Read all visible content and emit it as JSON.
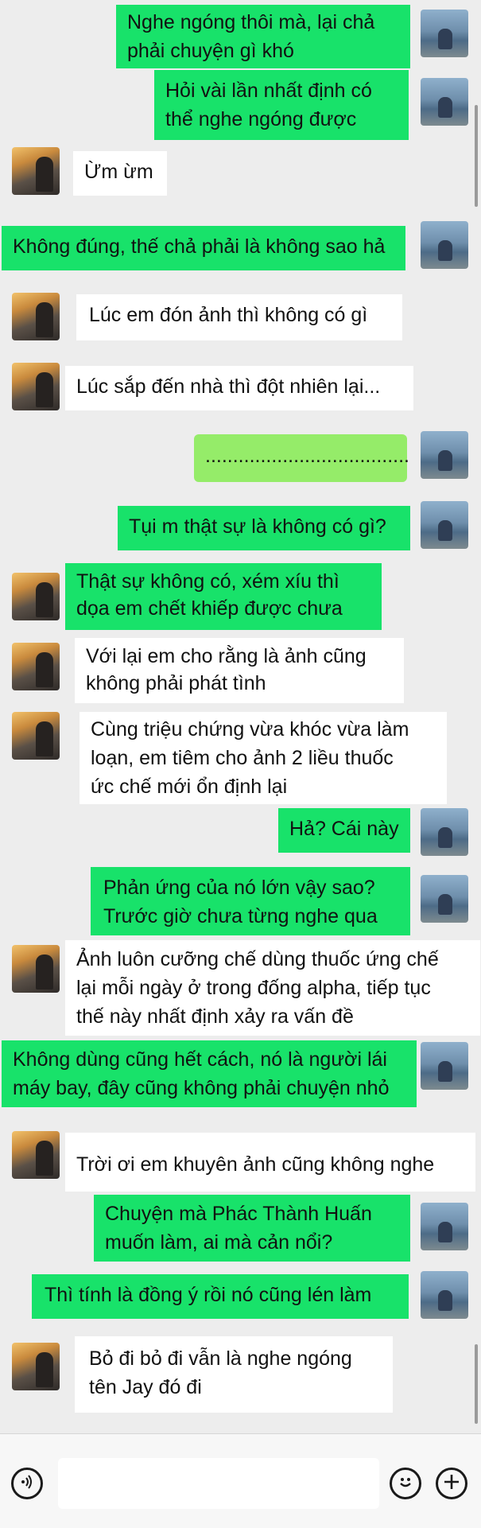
{
  "messages": [
    {
      "text": "Nghe ngóng thôi mà, lại chả\nphải chuyện gì khó"
    },
    {
      "text": "Hỏi vài lần nhất định có\nthể nghe ngóng được"
    },
    {
      "text": "Ừm ừm"
    },
    {
      "text": "Không đúng, thế chả phải là không sao hả"
    },
    {
      "text": "Lúc em đón ảnh thì không có gì"
    },
    {
      "text": "Lúc sắp đến nhà thì đột nhiên lại..."
    },
    {
      "text": "....................................."
    },
    {
      "text": "Tụi m thật sự là không có gì?"
    },
    {
      "text": "Thật sự không có,  xém xíu thì\ndọa em chết khiếp được chưa"
    },
    {
      "text": "Với lại em cho rằng là ảnh cũng\nkhông phải phát tình"
    },
    {
      "text": "Cùng triệu chứng vừa khóc vừa làm\nloạn, em tiêm cho ảnh 2 liều thuốc\nức chế mới ổn định lại"
    },
    {
      "text": "Hả? Cái này"
    },
    {
      "text": "Phản ứng của nó lớn vậy sao?\nTrước giờ chưa từng nghe qua"
    },
    {
      "text": "Ảnh luôn cưỡng chế dùng thuốc ứng chế\nlại mỗi ngày ở trong đống alpha, tiếp tục\nthế này nhất định xảy ra vấn đề"
    },
    {
      "text": "Không dùng cũng hết cách, nó là người lái\nmáy bay, đây cũng không phải chuyện nhỏ"
    },
    {
      "text": "Trời ơi em khuyên ảnh cũng không nghe"
    },
    {
      "text": "Chuyện mà Phác Thành Huấn\nmuốn làm, ai mà cản nổi?"
    },
    {
      "text": "Thì tính là đồng ý rồi nó cũng lén làm"
    },
    {
      "text": "Bỏ đi bỏ đi vẫn là nghe ngóng\ntên Jay đó đi"
    }
  ],
  "input_bar": {
    "placeholder": "",
    "icons": [
      "voice-icon",
      "emoji-icon",
      "plus-icon"
    ]
  },
  "colors": {
    "sent_bright": "#18e26a",
    "sent_light": "#95ec69",
    "received": "#ffffff",
    "background": "#ededed"
  }
}
